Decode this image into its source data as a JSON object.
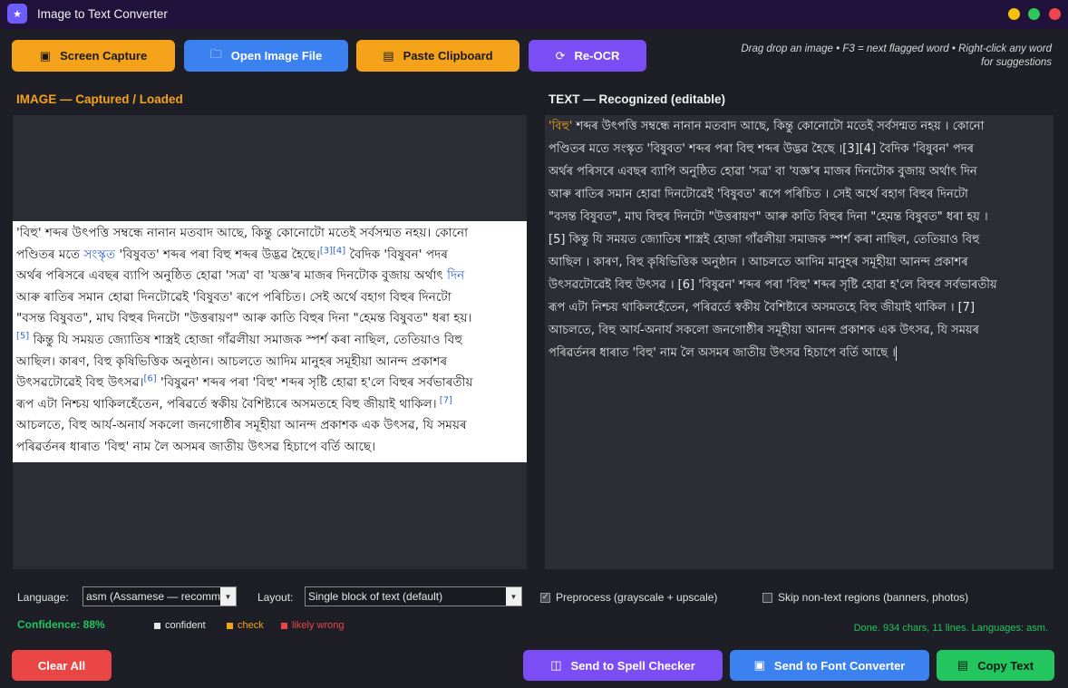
{
  "window": {
    "title": "Image to Text Converter",
    "app_icon": "app-logo-icon"
  },
  "toolbar": {
    "screen_capture": "Screen Capture",
    "open_image": "Open Image File",
    "paste_clipboard": "Paste Clipboard",
    "reocr": "Re-OCR",
    "hint_line1": "Drag  drop an image  •  F3 = next flagged word  •  Right-click any word",
    "hint_line2": "for suggestions"
  },
  "panes": {
    "image_label": "IMAGE — Captured / Loaded",
    "text_label": "TEXT — Recognized (editable)"
  },
  "captured_image": {
    "segments": [
      "'বিহু' শব্দৰ উৎপত্তি সম্বন্ধে নানান মতবাদ আছে, কিন্তু কোনোটো মতেই সৰ্বসন্মত নহয়। কোনো\nপণ্ডিতৰ মতে ",
      "সংস্কৃত",
      " 'বিষুবত' শব্দৰ পৰা বিহু শব্দৰ উদ্ভৱ হৈছে।",
      "[3][4]",
      " বৈদিক 'বিষুবন' পদৰ\nঅৰ্থৰ পৰিসৰে এবছৰ ব্যাপি অনুষ্ঠিত হোৱা 'সত্ৰ' বা 'যজ্ঞ'ৰ মাজৰ দিনটোক বুজায় অৰ্থাৎ ",
      "দিন",
      "\nআৰু ৰাতিৰ সমান হোৱা দিনটোৱেই 'বিষুবত' ৰূপে পৰিচিত। সেই অৰ্থে বহাগ বিহুৰ দিনটো\n\"বসন্ত বিষুবত\", মাঘ বিহুৰ দিনটো \"উত্তৰায়ণ\" আৰু কাতি বিহুৰ দিনা \"হেমন্ত বিষুবত\" ধৰা হয়।\n",
      "[5]",
      " কিন্তু যি সময়ত জ্যোতিষ শাস্ত্ৰই হোজা গাঁৱলীয়া সমাজক স্পৰ্শ কৰা নাছিল, তেতিয়াও বিহু\nআছিল। কাৰণ, বিহু কৃষিভিত্তিক অনুষ্ঠান। আচলতে আদিম মানুহৰ সমূহীয়া আনন্দ প্ৰকাশৰ\nউৎসৱটোৱেই বিহু উৎসৱ।",
      "[6]",
      " 'বিষুৱন' শব্দৰ পৰা 'বিহু' শব্দৰ সৃষ্টি হোৱা হ'লে বিহুৰ সৰ্বভাৰতীয়\nৰূপ এটা নিশ্চয় থাকিলহেঁতেন, পৰিৱৰ্তে স্বকীয় বৈশিষ্ট্যৰে অসমতহে বিহু জীয়াই থাকিল।",
      " [7]",
      "\nআচলতে, বিহু আৰ্য-অনাৰ্য সকলো জনগোষ্ঠীৰ সমূহীয়া আনন্দ প্ৰকাশক এক উৎসৱ, যি সময়ৰ\nপৰিৱৰ্তনৰ ধাৰাত 'বিহু' নাম লৈ অসমৰ জাতীয় উৎসৱ হিচাপে বৰ্তি আছে।"
    ]
  },
  "recognized_text": {
    "flagged": "'বিহু'",
    "body": " শব্দৰ উৎপত্তি সম্বন্ধে নানান মতবাদ আছে, কিন্তু কোনোটো মতেই সৰ্বসন্মত নহয় । কোনো\nপণ্ডিতৰ মতে সংস্কৃত 'বিষুবত' শব্দৰ পৰা বিহু শব্দৰ উদ্ভৱ হৈছে ।[3][4] বৈদিক 'বিষুবন' পদৰ\nঅৰ্থৰ পৰিসৰে এবছৰ ব্যাপি অনুষ্ঠিত হোৱা 'সত্ৰ' বা 'যজ্ঞ'ৰ মাজৰ দিনটোক বুজায় অৰ্থাৎ দিন\nআৰু ৰাতিৰ সমান হোৱা দিনটোৱেই 'বিষুবত' ৰূপে পৰিচিত । সেই অৰ্থে বহাগ বিহুৰ দিনটো\n\"বসন্ত বিষুবত\", মাঘ বিহুৰ দিনটো \"উত্তৰায়ণ\" আৰু কাতি বিহুৰ দিনা \"হেমন্ত বিষুবত\" ধৰা হয় ।\n[5] কিন্তু যি সময়ত জ্যোতিষ শাস্ত্ৰই হোজা গাঁৱলীয়া সমাজক স্পৰ্শ কৰা নাছিল, তেতিয়াও বিহু\nআছিল । কাৰণ, বিহু কৃষিভিত্তিক অনুষ্ঠান । আচলতে আদিম মানুহৰ সমূহীয়া আনন্দ প্ৰকাশৰ\nউৎসৱটোৱেই বিহু উৎসৱ । [6] 'বিষুৱন' শব্দৰ পৰা 'বিহু' শব্দৰ সৃষ্টি হোৱা হ'লে বিহুৰ সৰ্বভাৰতীয়\nৰূপ এটা নিশ্চয় থাকিলহেঁতেন, পৰিৱৰ্তে স্বকীয় বৈশিষ্ট্যৰে অসমতহে বিহু জীয়াই থাকিল । [7]\nআচলতে, বিহু আৰ্য-অনাৰ্য সকলো জনগোষ্ঠীৰ সমূহীয়া আনন্দ প্ৰকাশক এক উৎসৱ, যি সময়ৰ\nপৰিৱৰ্তনৰ ধাৰাত 'বিহু' নাম লৈ অসমৰ জাতীয় উৎসৱ হিচাপে বৰ্তি আছে ।"
  },
  "options": {
    "language_label": "Language:",
    "language_value": "asm  (Assamese — recommended)",
    "layout_label": "Layout:",
    "layout_value": "Single block of text (default)",
    "preprocess_label": "Preprocess (grayscale + upscale)",
    "preprocess_checked": true,
    "skip_label": "Skip non-text regions  (banners, photos)",
    "skip_checked": false
  },
  "legend": {
    "confidence": "Confidence: 88%",
    "confident": "confident",
    "check": "check",
    "likely_wrong": "likely wrong",
    "colors": {
      "confident": "#e6e6e6",
      "check": "#f5a21b",
      "likely_wrong": "#ea4645"
    }
  },
  "status": "Done. 934 chars, 11 lines. Languages: asm.",
  "footer": {
    "clear_all": "Clear All",
    "spell_checker": "Send to Spell Checker",
    "font_converter": "Send to Font Converter",
    "copy_text": "Copy Text"
  },
  "colors": {
    "accent_orange": "#f5a21b",
    "accent_blue": "#3b82f0",
    "accent_purple": "#7b4df5",
    "accent_green": "#22c55e",
    "accent_red": "#ea4645"
  }
}
